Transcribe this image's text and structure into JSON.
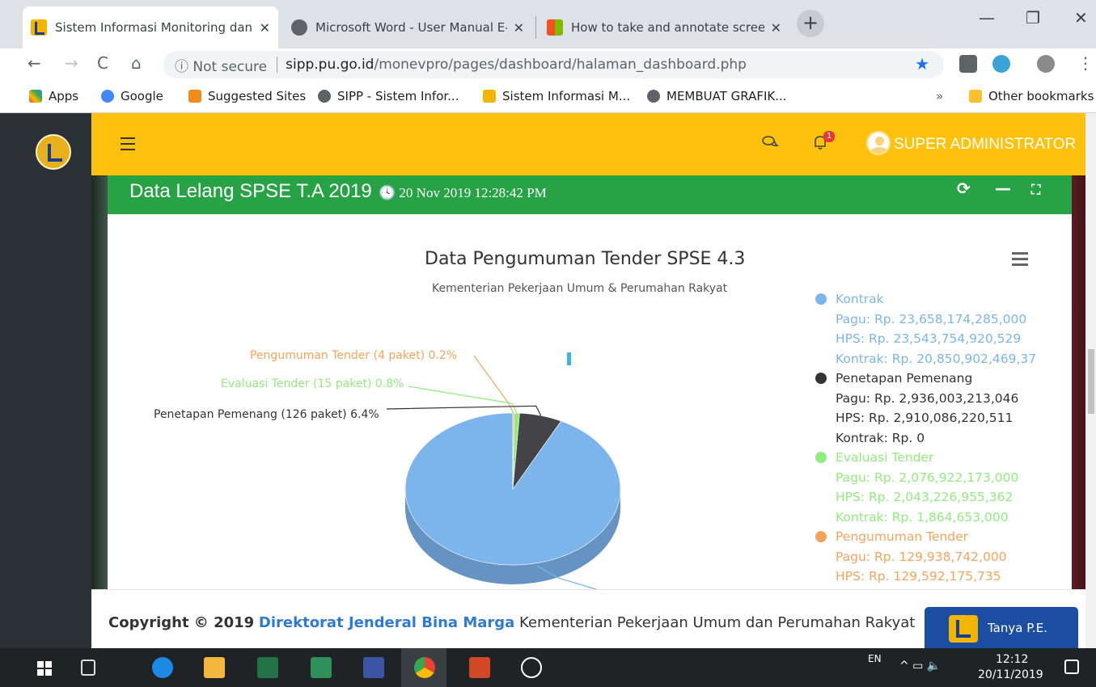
{
  "browser": {
    "tabs": [
      {
        "title": "Sistem Informasi Monitoring dan",
        "close": "✕",
        "active": true
      },
      {
        "title": "Microsoft Word - User Manual E-",
        "close": "✕",
        "active": false
      },
      {
        "title": "How to take and annotate screen",
        "close": "✕",
        "active": false
      }
    ],
    "new_tab": "+",
    "window_controls": {
      "minimize": "—",
      "restore": "❐",
      "close": "✕"
    },
    "nav": {
      "back": "←",
      "forward": "→",
      "reload": "C",
      "home": "⌂"
    },
    "address": {
      "security": "ⓘ Not secure",
      "domain": "sipp.pu.go.id",
      "path": "/monevpro/pages/dashboard/halaman_dashboard.php"
    },
    "star": "★",
    "menu": "⋮",
    "bookmarks": [
      "Apps",
      "Google",
      "Suggested Sites",
      "SIPP - Sistem Infor...",
      "Sistem Informasi M...",
      "MEMBUAT GRAFIK..."
    ],
    "bookmarks_more": "»",
    "other_bookmarks": "Other bookmarks"
  },
  "app": {
    "user": "SUPER ADMINISTRATOR",
    "notification_count": "1",
    "icons": {
      "chat": "chat-icon",
      "bell": "bell-icon",
      "menu": "hamburger-icon"
    }
  },
  "panel": {
    "title": "Data Lelang SPSE T.A 2019",
    "timestamp": "20 Nov 2019 12:28:42 PM",
    "tools": {
      "refresh": "⟳",
      "collapse": "—",
      "expand": "⛶"
    }
  },
  "chart_data": {
    "type": "pie",
    "title": "Data Pengumuman Tender SPSE 4.3",
    "subtitle": "Kementerian Pekerjaan Umum & Perumahan Rakyat",
    "slices": [
      {
        "name": "Kontrak",
        "percent": 92.6,
        "color": "#7cb5ec"
      },
      {
        "name": "Penetapan Pemenang",
        "percent": 6.4,
        "color": "#434348"
      },
      {
        "name": "Evaluasi Tender",
        "percent": 0.8,
        "color": "#90ed7d"
      },
      {
        "name": "Pengumuman Tender",
        "percent": 0.2,
        "color": "#f7a35c"
      }
    ],
    "data_labels": [
      {
        "text": "Pengumuman Tender (4 paket) 0.2%",
        "color": "#f7a35c"
      },
      {
        "text": "Evaluasi Tender (15 paket) 0.8%",
        "color": "#90ed7d"
      },
      {
        "text": "Penetapan Pemenang (126 paket) 6.4%",
        "color": "#333333"
      }
    ],
    "legend": [
      {
        "name": "Kontrak",
        "color": "#7cb5ec",
        "lines": [
          "Pagu: Rp. 23,658,174,285,000",
          "HPS: Rp. 23,543,754,920,529",
          "Kontrak: Rp. 20,850,902,469,37"
        ]
      },
      {
        "name": "Penetapan Pemenang",
        "color": "#333333",
        "lines": [
          "Pagu: Rp. 2,936,003,213,046",
          "HPS: Rp. 2,910,086,220,511",
          "Kontrak: Rp. 0"
        ]
      },
      {
        "name": "Evaluasi Tender",
        "color": "#90ed7d",
        "lines": [
          "Pagu: Rp. 2,076,922,173,000",
          "HPS: Rp. 2,043,226,955,362",
          "Kontrak: Rp. 1,864,653,000"
        ]
      },
      {
        "name": "Pengumuman Tender",
        "color": "#f7a35c",
        "lines": [
          "Pagu: Rp. 129,938,742,000",
          "HPS: Rp. 129,592,175,735"
        ]
      }
    ]
  },
  "footer": {
    "prefix": "Copyright © 2019",
    "link": "Direktorat Jenderal Bina Marga",
    "suffix": "Kementerian Pekerjaan Umum dan Perumahan Rakyat",
    "chat_button": "Tanya P.E."
  },
  "taskbar": {
    "lang": "EN",
    "time": "12:12",
    "date": "20/11/2019"
  }
}
